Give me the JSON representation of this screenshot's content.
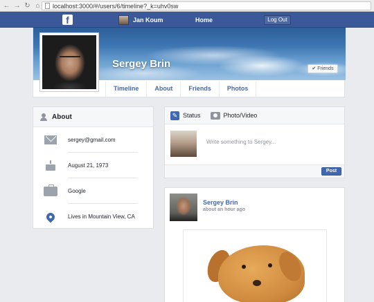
{
  "browser": {
    "url": "localhost:3000/#/users/6/timeline?_k=uhv0sw"
  },
  "topbar": {
    "user_name": "Jan Koum",
    "home_label": "Home",
    "logout_label": "Log Out",
    "accent": "#3b5998"
  },
  "profile": {
    "name": "Sergey Brin",
    "friends_label": "Friends",
    "tabs": [
      {
        "label": "Timeline"
      },
      {
        "label": "About"
      },
      {
        "label": "Friends"
      },
      {
        "label": "Photos"
      }
    ]
  },
  "about": {
    "title": "About",
    "items": [
      {
        "icon": "envelope-icon",
        "text": "sergey@gmail.com"
      },
      {
        "icon": "birthday-cake-icon",
        "text": "August 21, 1973"
      },
      {
        "icon": "briefcase-icon",
        "text": "Google"
      },
      {
        "icon": "location-pin-icon",
        "text": "Lives in Mountain View, CA"
      }
    ]
  },
  "composer": {
    "status_label": "Status",
    "photo_label": "Photo/Video",
    "placeholder": "Write something to Sergey...",
    "post_label": "Post"
  },
  "post": {
    "author": "Sergey Brin",
    "time": "about an hour ago"
  }
}
